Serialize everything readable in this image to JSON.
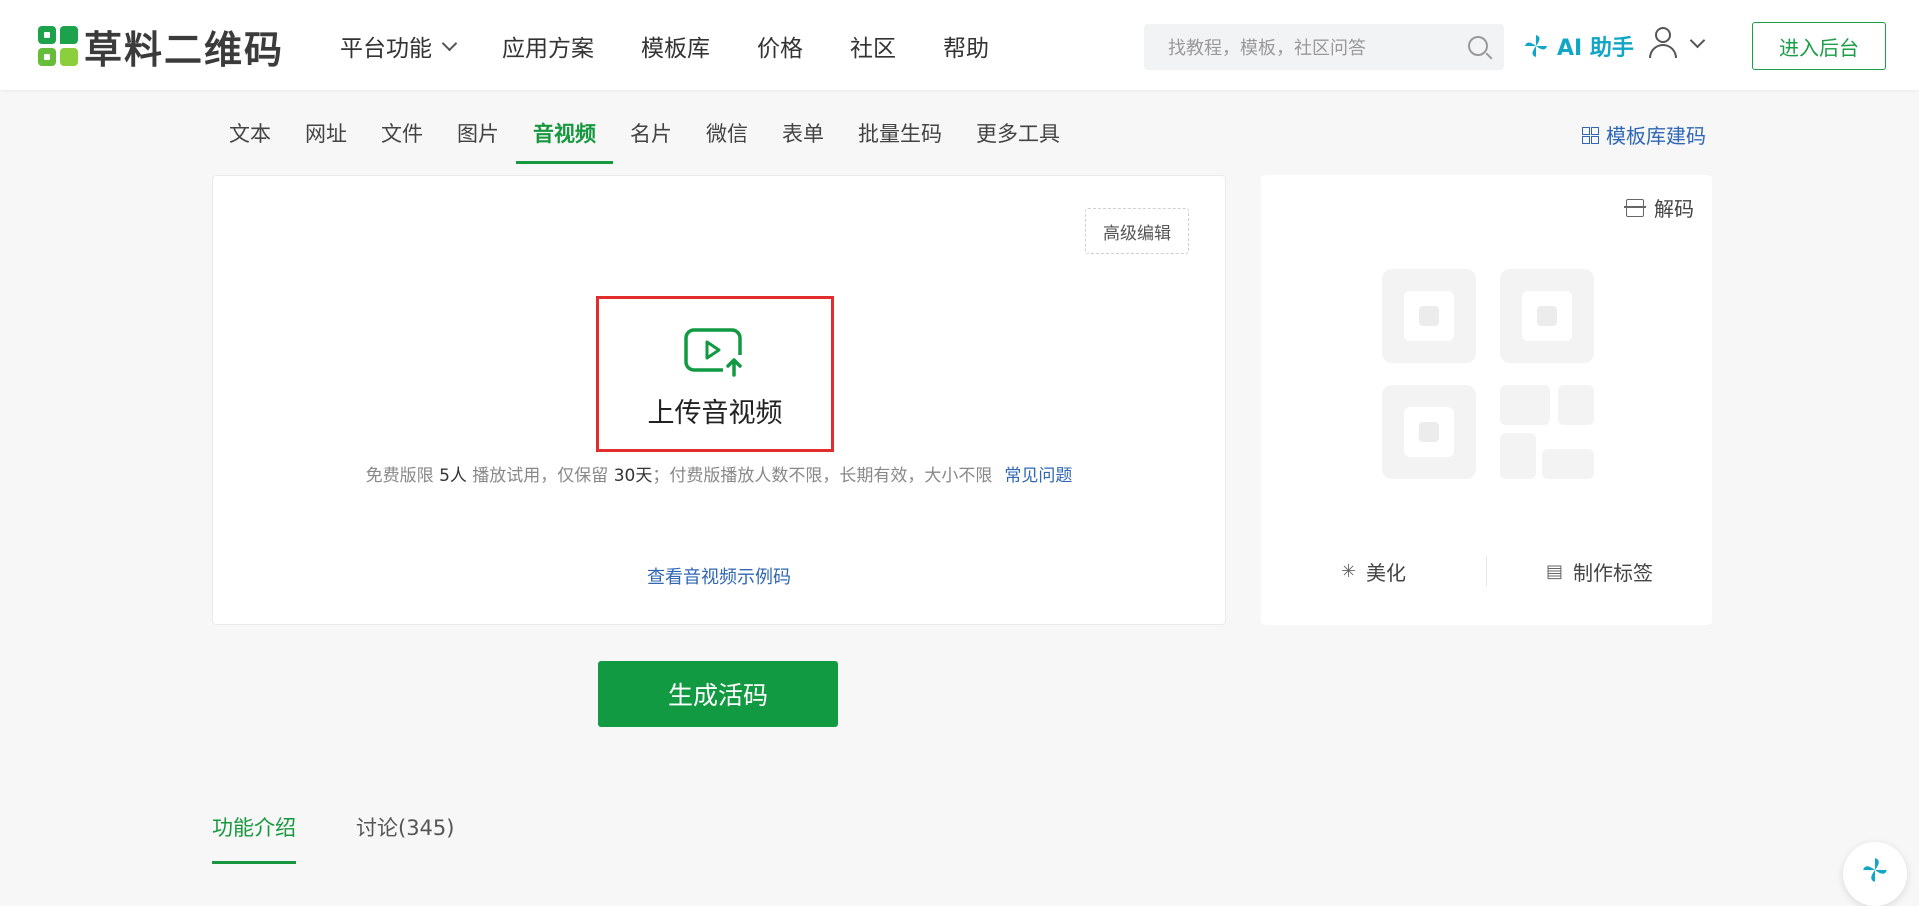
{
  "header": {
    "logo_text": "草料二维码",
    "nav": [
      {
        "label": "平台功能",
        "has_dropdown": true
      },
      {
        "label": "应用方案"
      },
      {
        "label": "模板库"
      },
      {
        "label": "价格"
      },
      {
        "label": "社区"
      },
      {
        "label": "帮助"
      }
    ],
    "search": {
      "placeholder": "找教程，模板，社区问答",
      "value": ""
    },
    "ai_helper_label": "AI 助手",
    "enter_backend_label": "进入后台"
  },
  "tabs": {
    "items": [
      "文本",
      "网址",
      "文件",
      "图片",
      "音视频",
      "名片",
      "微信",
      "表单",
      "批量生码",
      "更多工具"
    ],
    "active": "音视频",
    "template_link": "模板库建码"
  },
  "main": {
    "advanced_edit": "高级编辑",
    "upload_label": "上传音视频",
    "notice": {
      "part1": "免费版限 ",
      "limit_people": "5人",
      "part2": " 播放试用，仅保留 ",
      "limit_days": "30天",
      "part3": "；付费版播放人数不限，长期有效，大小不限",
      "faq_link": "常见问题"
    },
    "example_link": "查看音视频示例码",
    "generate_button": "生成活码"
  },
  "qr_panel": {
    "decode_label": "解码",
    "beautify_label": "美化",
    "make_label_label": "制作标签"
  },
  "bottom_tabs": {
    "items": [
      "功能介绍",
      "讨论(345)"
    ],
    "active": "功能介绍"
  },
  "colors": {
    "brand_green": "#129a43",
    "link_blue": "#2f67b5",
    "ai_cyan": "#11a5c6",
    "highlight_red": "#e22d2d"
  }
}
